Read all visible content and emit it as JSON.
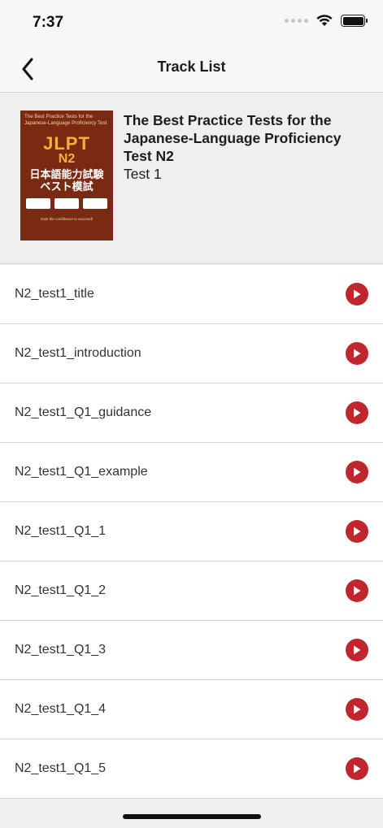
{
  "status_bar": {
    "time": "7:37",
    "icons": [
      "signal-icon",
      "wifi-icon",
      "battery-icon"
    ]
  },
  "nav": {
    "back_icon": "chevron-left-icon",
    "title": "Track List"
  },
  "book": {
    "title": "The Best Practice Tests for the Japanese-Language Proficiency Test N2",
    "subtitle": "Test 1",
    "cover": {
      "top_text": "The Best Practice Tests for the Japanese-Language Proficiency Test",
      "jlpt": "JLPT",
      "level": "N2",
      "jp_line1": "日本語能力試験",
      "jp_line2": "ベスト模試",
      "footer": "Gain the confidence to succeed!"
    }
  },
  "tracks": [
    {
      "name": "N2_test1_title"
    },
    {
      "name": "N2_test1_introduction"
    },
    {
      "name": "N2_test1_Q1_guidance"
    },
    {
      "name": "N2_test1_Q1_example"
    },
    {
      "name": "N2_test1_Q1_1"
    },
    {
      "name": "N2_test1_Q1_2"
    },
    {
      "name": "N2_test1_Q1_3"
    },
    {
      "name": "N2_test1_Q1_4"
    },
    {
      "name": "N2_test1_Q1_5"
    }
  ],
  "colors": {
    "accent": "#c0262e",
    "background": "#efeff0",
    "cover": "#7a2a12"
  }
}
